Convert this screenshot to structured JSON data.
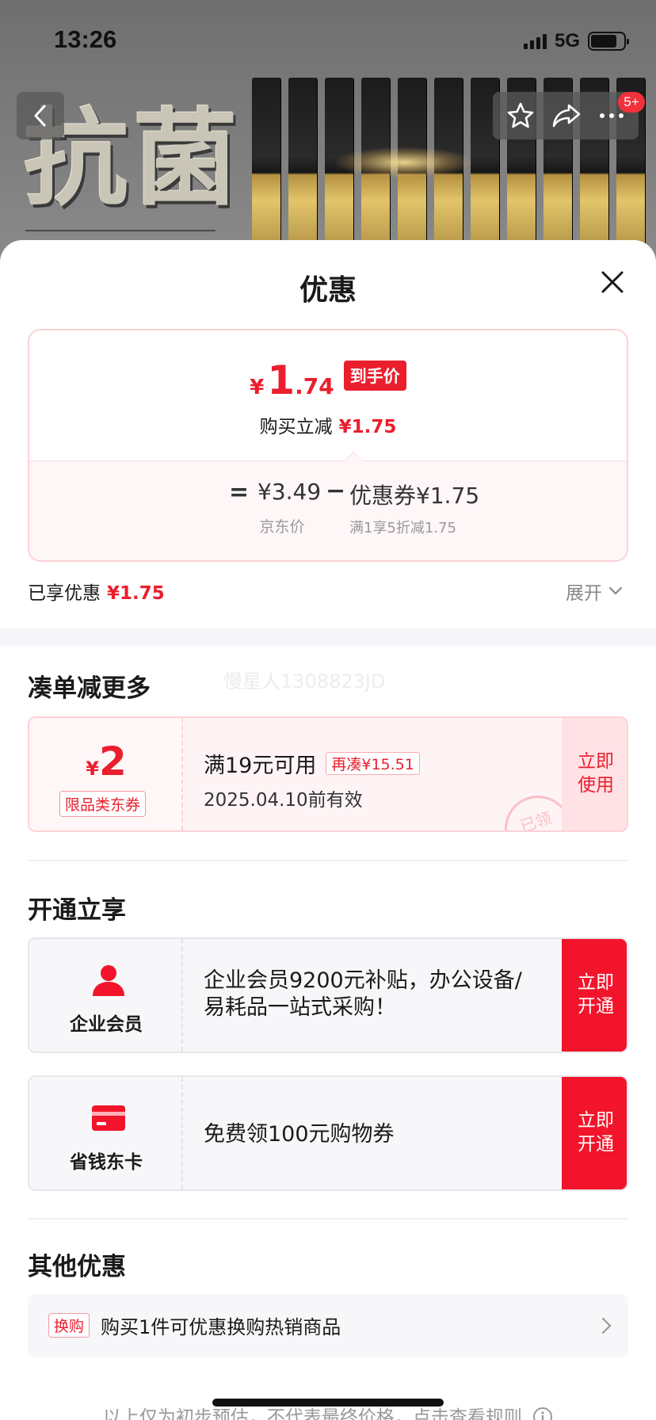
{
  "status_bar": {
    "time": "13:26",
    "network": "5G",
    "battery_level": 0.8
  },
  "product_banner": {
    "headline": "抗菌"
  },
  "nav": {
    "badge": "5+"
  },
  "sheet": {
    "title": "优惠"
  },
  "price": {
    "final_currency": "¥",
    "final_integer": "1",
    "final_decimal": ".74",
    "final_tag": "到手价",
    "instant_label": "购买立减",
    "instant_value": "¥1.75",
    "equals": "=",
    "jd_price": "¥3.49",
    "jd_label": "京东价",
    "minus": "−",
    "coupon_value": "优惠券¥1.75",
    "coupon_rule": "满1享5折减1.75"
  },
  "enjoyed": {
    "label": "已享优惠",
    "value": "¥1.75",
    "expand": "展开"
  },
  "section_more": {
    "title": "凑单减更多",
    "watermark": "慢星人1308823JD",
    "coupon": {
      "currency": "¥",
      "amount": "2",
      "type": "限品类东券",
      "condition": "满19元可用",
      "need_more": "再凑¥15.51",
      "validity": "2025.04.10前有效",
      "button": "立即使用",
      "stamp": "已领"
    }
  },
  "section_open": {
    "title": "开通立享",
    "cards": [
      {
        "label": "企业会员",
        "icon": "person-icon",
        "desc": "企业会员9200元补贴，办公设备/易耗品一站式采购！",
        "button": "立即开通"
      },
      {
        "label": "省钱东卡",
        "icon": "card-icon",
        "desc": "免费领100元购物券",
        "button": "立即开通"
      }
    ]
  },
  "section_other": {
    "title": "其他优惠",
    "row": {
      "tag": "换购",
      "text": "购买1件可优惠换购热销商品"
    }
  },
  "footer": {
    "note": "以上仅为初步预估，不代表最终价格，点击查看规则"
  },
  "colors": {
    "accent": "#ea1e2d",
    "open_button": "#f2142b"
  }
}
